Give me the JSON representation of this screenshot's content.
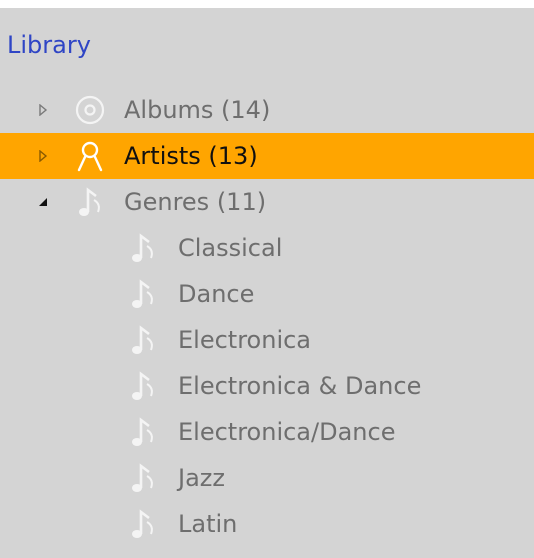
{
  "header": {
    "title": "Library"
  },
  "colors": {
    "panel_background": "#d4d4d4",
    "selection": "#ffa500",
    "header_text": "#2f45c5",
    "item_text": "#6e6e6e",
    "selected_text": "#101010"
  },
  "tree": {
    "albums": {
      "label": "Albums (14)",
      "icon": "disc-icon",
      "expanded": false
    },
    "artists": {
      "label": "Artists (13)",
      "icon": "person-icon",
      "expanded": false,
      "selected": true
    },
    "genres": {
      "label": "Genres (11)",
      "icon": "music-note-icon",
      "expanded": true,
      "children": [
        {
          "label": "Classical",
          "icon": "music-note-icon"
        },
        {
          "label": "Dance",
          "icon": "music-note-icon"
        },
        {
          "label": "Electronica",
          "icon": "music-note-icon"
        },
        {
          "label": "Electronica & Dance",
          "icon": "music-note-icon"
        },
        {
          "label": "Electronica/Dance",
          "icon": "music-note-icon"
        },
        {
          "label": "Jazz",
          "icon": "music-note-icon"
        },
        {
          "label": "Latin",
          "icon": "music-note-icon"
        }
      ]
    }
  }
}
